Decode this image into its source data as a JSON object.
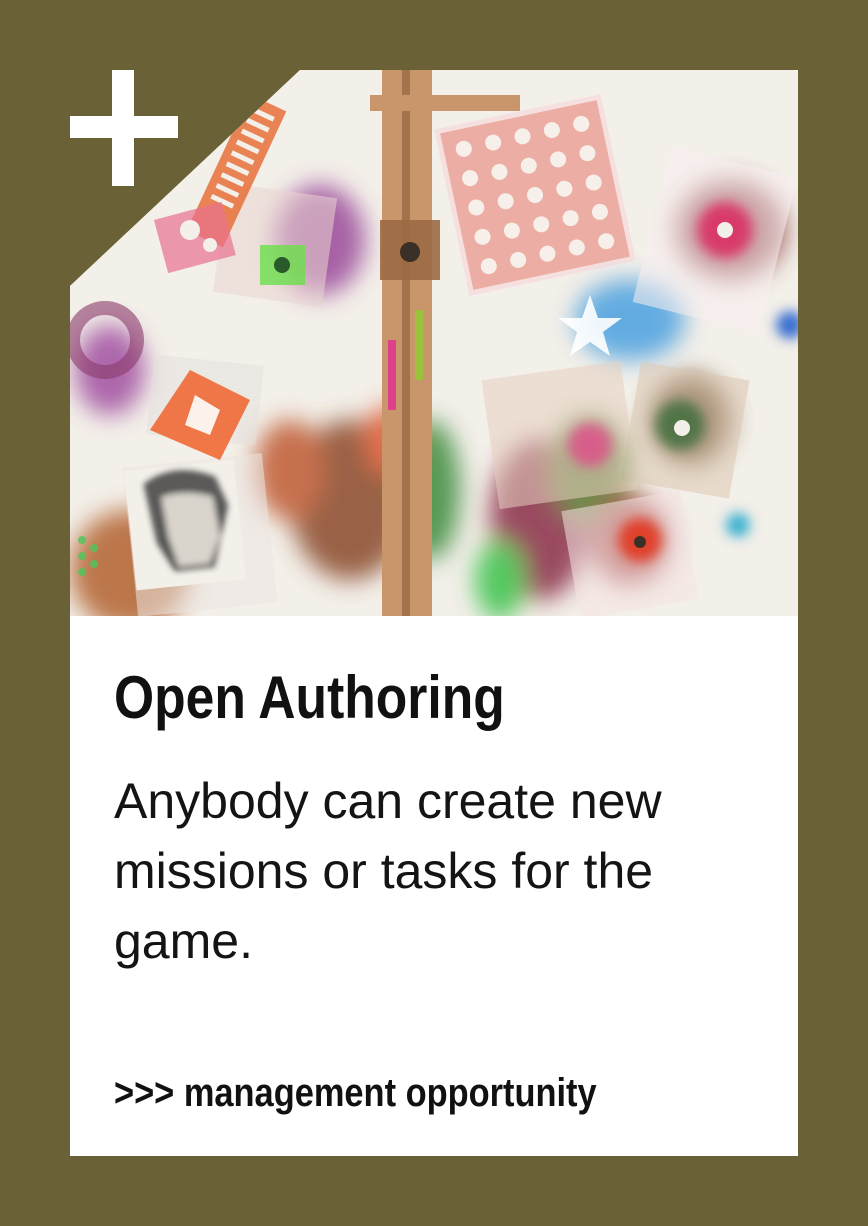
{
  "card": {
    "icon": "plus-icon",
    "title": "Open Authoring",
    "description": "Anybody can create new missions or tasks for the game.",
    "tag": ">>> management opportunity"
  },
  "colors": {
    "frame": "#6b6136",
    "panel": "#ffffff",
    "text": "#111111"
  }
}
